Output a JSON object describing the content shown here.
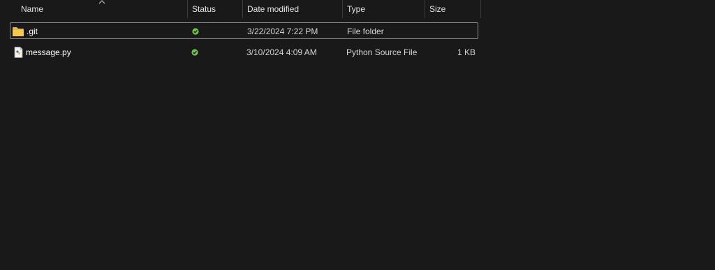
{
  "columns": {
    "name": "Name",
    "status": "Status",
    "date_modified": "Date modified",
    "type": "Type",
    "size": "Size"
  },
  "files": [
    {
      "name": ".git",
      "status": "synced",
      "date_modified": "3/22/2024 7:22 PM",
      "type": "File folder",
      "size": "",
      "icon": "folder-icon",
      "selected": true
    },
    {
      "name": "message.py",
      "status": "synced",
      "date_modified": "3/10/2024 4:09 AM",
      "type": "Python Source File",
      "size": "1 KB",
      "icon": "python-file-icon",
      "selected": false
    }
  ],
  "colors": {
    "background": "#191919",
    "status_ok": "#6cc644",
    "folder": "#f0c24b"
  }
}
